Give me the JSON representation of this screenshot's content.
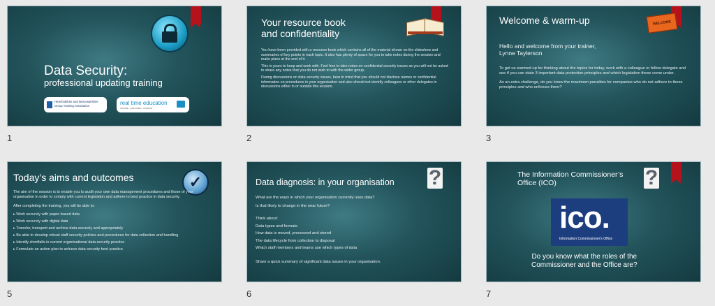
{
  "slides": [
    {
      "number": "1",
      "title": "Data Security:",
      "subtitle": "professional updating training",
      "logo1_line1": "Herefordshire and Worcestershire",
      "logo1_line2": "Group Training Association",
      "logo2_text": "real time education",
      "logo2_tag": "INSPIRE · EMPOWER · ACHIEVE"
    },
    {
      "number": "2",
      "title_line1": "Your resource book",
      "title_line2": "and confidentiality",
      "para1": "You have been provided with a resource book which contains all of the material shown on the slideshow and summaries of key points in each topic. It also has plenty of space for you to take notes during the session and make plans at the end of it.",
      "para2": "This is yours to keep and work with. Feel free to take notes on confidential security issues as you will not be asked to share any notes that you do not wish to with the wider group.",
      "para3": "During discussions on data security issues, bear in mind that you should not disclose names or confidential information on procedures in your organisation and also should not identify colleagues or other delegates in discussions either in or outside this session."
    },
    {
      "number": "3",
      "title": "Welcome & warm-up",
      "welcome_line1": "Hello and welcome from your trainer,",
      "welcome_line2": "Lynne Taylerson",
      "para1": "To get us warmed up for thinking about the topics for today, work with a colleague or fellow delegate and see if you can state 3 important data protection principles and which legislation these come under.",
      "para2": "As an extra challenge, do you know the maximum penalties for companies who do not adhere to these principles and who enforces them?",
      "sign_text": "WELCOME"
    },
    {
      "number": "5",
      "title": "Today’s aims and outcomes",
      "para1": "The aim of the session is to enable you to audit your own data management procedures and those of your organisation in order to comply with current legislation and adhere to best practice in data security.",
      "para2": "After completing the training, you will be able to:",
      "bullets": [
        "Work securely with paper-based data",
        "Work securely with digital data",
        "Transfer, transport and archive data securely and appropriately",
        "Be able to develop robust staff security policies and procedures for data collection and handling",
        "Identify shortfalls in current organisational data security practice",
        "Formulate an action plan to achieve data security best practice."
      ]
    },
    {
      "number": "6",
      "title": "Data diagnosis: in your organisation",
      "line1": "What are the ways in which your organisation currently uses data?",
      "line2": "Is that likely to change in the near future?",
      "think": "Think about:",
      "items": [
        "Data types and formats",
        "How data is moved, processed and stored",
        "The data lifecycle from collection to disposal",
        "Which staff members and teams use which types of data"
      ],
      "share": "Share a quick summary of significant data issues in your organisation."
    },
    {
      "number": "7",
      "title_line1": "The Information Commissioner’s",
      "title_line2": "Office (ICO)",
      "ico_text": "ico.",
      "ico_sub": "Information Commissioner's Office",
      "question_line1": "Do you know what the roles of the",
      "question_line2": "Commissioner and the Office are?"
    }
  ],
  "colors": {
    "ribbon": "#b5121b",
    "ico_blue": "#1d3e7e"
  }
}
